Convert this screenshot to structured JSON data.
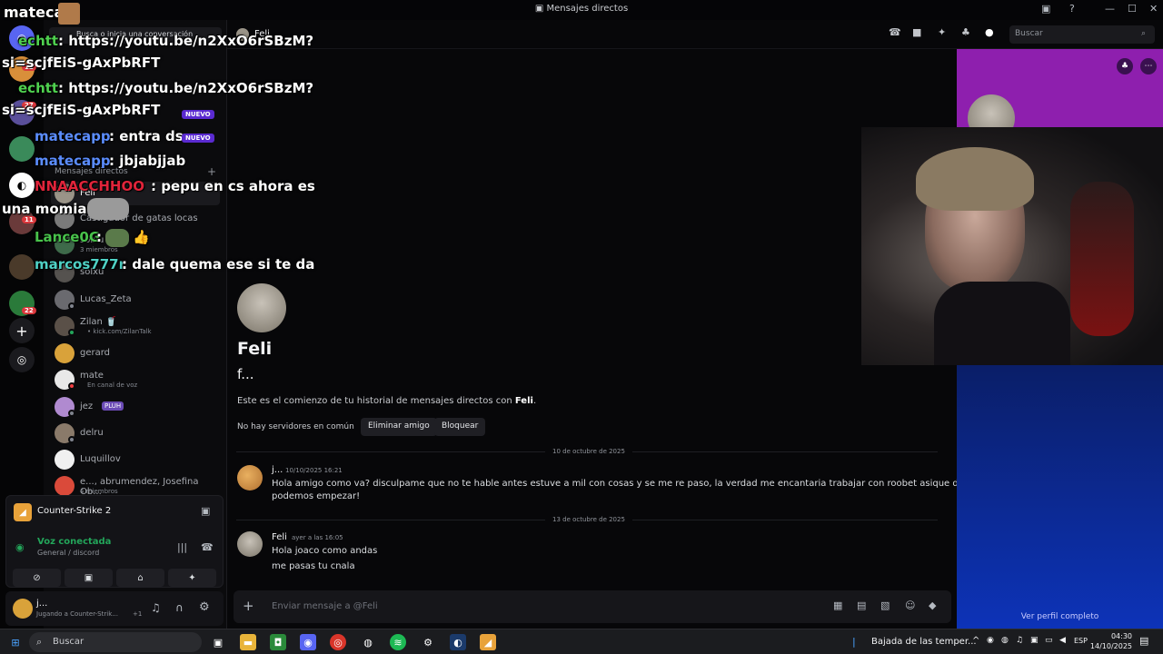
{
  "window": {
    "title": "Mensajes directos",
    "channel_name": "Feli"
  },
  "server_badges": [
    "12",
    "27",
    "11",
    "22"
  ],
  "dm_sidebar": {
    "search_placeholder": "Busca o inicia una conversación",
    "section_label": "Mensajes directos",
    "items": [
      {
        "name": "Feli",
        "sub": ""
      },
      {
        "name": "Castigador de gatas locas",
        "sub": ""
      },
      {
        "name": "solxu",
        "sub": "3 miembros"
      },
      {
        "name": "solxu",
        "sub": ""
      },
      {
        "name": "Lucas_Zeta",
        "sub": ""
      },
      {
        "name": "Zilan 🥤",
        "sub": "• kick.com/ZilanTalk"
      },
      {
        "name": "gerard",
        "sub": ""
      },
      {
        "name": "mate",
        "sub": "En canal de voz"
      },
      {
        "name": "jez",
        "sub": "",
        "badge": "PLUH"
      },
      {
        "name": "delru",
        "sub": ""
      },
      {
        "name": "Luquillov",
        "sub": ""
      },
      {
        "name": "e..., abrumendez, Josefina Ob...",
        "sub": "4 miembros"
      }
    ]
  },
  "activity": {
    "game": "Counter-Strike 2"
  },
  "voice": {
    "status": "Voz conectada",
    "channel": "General / discord"
  },
  "user": {
    "name": "j...",
    "status": "Jugando a Counter-Strik...",
    "extra": "+1"
  },
  "header": {
    "search_placeholder": "Buscar"
  },
  "profile_intro": {
    "name": "Feli",
    "username": "f...",
    "intro_text": "Este es el comienzo de tu historial de mensajes directos con ",
    "intro_name": "Feli",
    "intro_end": ".",
    "no_servers": "No hay servidores en común",
    "remove_friend": "Eliminar amigo",
    "block": "Bloquear"
  },
  "messages": [
    {
      "date": "10 de octubre de 2025",
      "author": "j...",
      "time": "10/10/2025 16:21",
      "lines": [
        "Hola amigo como va? disculpame que no te hable antes estuve a mil con cosas y se me re paso, la verdad me encantaria trabajar con roobet asique decime como",
        "podemos empezar!"
      ]
    },
    {
      "date": "13 de octubre de 2025",
      "author": "Feli",
      "time": "ayer a las 16:05",
      "lines": [
        "Hola joaco como andas",
        "me pasas tu cnala"
      ]
    }
  ],
  "composer": {
    "placeholder": "Enviar mensaje a @Feli"
  },
  "profile_panel": {
    "view_full": "Ver perfil completo"
  },
  "chat_overlay": {
    "header": "mateca",
    "lines": [
      {
        "user": "echtt",
        "text": ": https://youtu.be/n2XxO6rSBzM?",
        "cont": "si=scjfEiS-gAxPbRFT",
        "color": "#4fd14f"
      },
      {
        "user": "echtt",
        "text": ": https://youtu.be/n2XxO6rSBzM?",
        "cont": "si=scjfEiS-gAxPbRFT",
        "color": "#4fd14f"
      },
      {
        "user": "matecapp",
        "text": ": entra ds",
        "cont": "",
        "color": "#5b8dff"
      },
      {
        "user": "matecapp",
        "text": ": jbjabjjab",
        "cont": "",
        "color": "#5b8dff"
      },
      {
        "user": "NNAACCHHOO",
        "text": ": pepu en cs ahora es",
        "cont": "una momia",
        "color": "#e0243a"
      },
      {
        "user": "Lance0G",
        "text": ":",
        "cont": "",
        "color": "#48c24b"
      },
      {
        "user": "marcos777r",
        "text": ": dale quema ese si te da",
        "cont": "",
        "color": "#4fd1c5"
      }
    ],
    "badges_nuevo": [
      "NUEVO",
      "NUEVO"
    ]
  },
  "taskbar": {
    "search": "Buscar",
    "weather": "Bajada de las temper...",
    "lang": "ESP",
    "time": "04:30",
    "date": "14/10/2025"
  }
}
